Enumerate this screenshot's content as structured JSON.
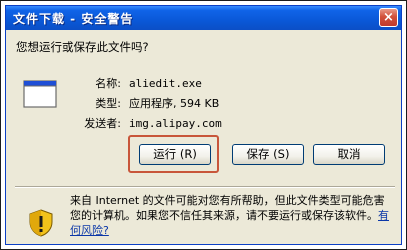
{
  "dialog": {
    "title": "文件下载 - 安全警告",
    "close_symbol": "×",
    "question": "您想运行或保存此文件吗?"
  },
  "file": {
    "name_label": "名称:",
    "name_value": "aliedit.exe",
    "type_label": "类型:",
    "type_value": "应用程序, 594 KB",
    "from_label": "发送者:",
    "from_value": "img.alipay.com"
  },
  "buttons": {
    "run": "运行 (R)",
    "save": "保存 (S)",
    "cancel": "取消"
  },
  "warning": {
    "text": "来自 Internet 的文件可能对您有所帮助，但此文件类型可能危害您的计算机。如果您不信任其来源，请不要运行或保存该软件。",
    "link": "有何风险?"
  },
  "colors": {
    "title_bar": "#0b58d8",
    "dialog_bg": "#ece9d8",
    "focus_frame": "#c8563a",
    "link": "#0b37a8"
  }
}
